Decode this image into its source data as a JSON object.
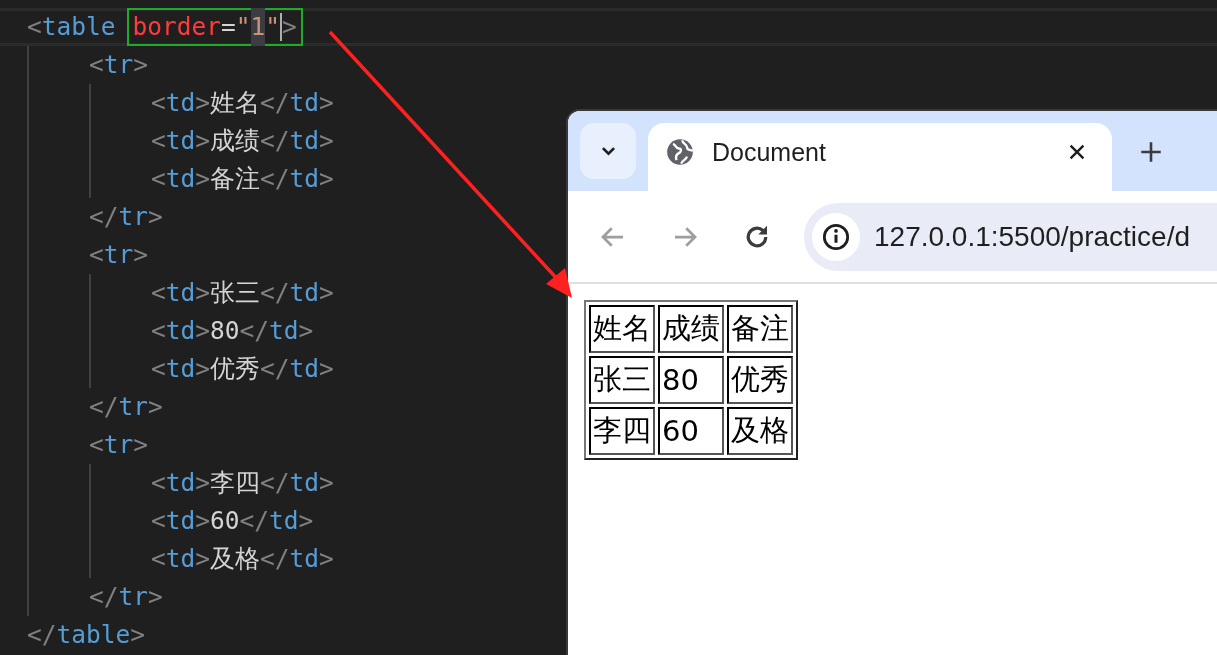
{
  "editor": {
    "lines": [
      {
        "current": true,
        "tokens": [
          {
            "kind": "punct",
            "text": "<"
          },
          {
            "kind": "tag",
            "text": "table"
          },
          {
            "kind": "boxed",
            "tokens": [
              {
                "kind": "attr",
                "text": "border"
              },
              {
                "kind": "plain",
                "text": "="
              },
              {
                "kind": "string",
                "text": "\""
              },
              {
                "kind": "string",
                "text": "1",
                "selected": true
              },
              {
                "kind": "string",
                "text": "\""
              },
              {
                "kind": "cursor"
              },
              {
                "kind": "punct",
                "text": ">"
              }
            ]
          }
        ],
        "children": [
          {
            "tokens": [
              {
                "kind": "punct",
                "text": "<"
              },
              {
                "kind": "tag",
                "text": "tr"
              },
              {
                "kind": "punct",
                "text": ">"
              }
            ],
            "children": [
              {
                "tokens": [
                  {
                    "kind": "punct",
                    "text": "<"
                  },
                  {
                    "kind": "tag",
                    "text": "td"
                  },
                  {
                    "kind": "punct",
                    "text": ">"
                  },
                  {
                    "kind": "plain",
                    "text": "姓名"
                  },
                  {
                    "kind": "punct",
                    "text": "</"
                  },
                  {
                    "kind": "tag",
                    "text": "td"
                  },
                  {
                    "kind": "punct",
                    "text": ">"
                  }
                ]
              },
              {
                "tokens": [
                  {
                    "kind": "punct",
                    "text": "<"
                  },
                  {
                    "kind": "tag",
                    "text": "td"
                  },
                  {
                    "kind": "punct",
                    "text": ">"
                  },
                  {
                    "kind": "plain",
                    "text": "成绩"
                  },
                  {
                    "kind": "punct",
                    "text": "</"
                  },
                  {
                    "kind": "tag",
                    "text": "td"
                  },
                  {
                    "kind": "punct",
                    "text": ">"
                  }
                ]
              },
              {
                "tokens": [
                  {
                    "kind": "punct",
                    "text": "<"
                  },
                  {
                    "kind": "tag",
                    "text": "td"
                  },
                  {
                    "kind": "punct",
                    "text": ">"
                  },
                  {
                    "kind": "plain",
                    "text": "备注"
                  },
                  {
                    "kind": "punct",
                    "text": "</"
                  },
                  {
                    "kind": "tag",
                    "text": "td"
                  },
                  {
                    "kind": "punct",
                    "text": ">"
                  }
                ]
              }
            ]
          },
          {
            "tokens": [
              {
                "kind": "punct",
                "text": "</"
              },
              {
                "kind": "tag",
                "text": "tr"
              },
              {
                "kind": "punct",
                "text": ">"
              }
            ]
          },
          {
            "tokens": [
              {
                "kind": "punct",
                "text": "<"
              },
              {
                "kind": "tag",
                "text": "tr"
              },
              {
                "kind": "punct",
                "text": ">"
              }
            ],
            "children": [
              {
                "tokens": [
                  {
                    "kind": "punct",
                    "text": "<"
                  },
                  {
                    "kind": "tag",
                    "text": "td"
                  },
                  {
                    "kind": "punct",
                    "text": ">"
                  },
                  {
                    "kind": "plain",
                    "text": "张三"
                  },
                  {
                    "kind": "punct",
                    "text": "</"
                  },
                  {
                    "kind": "tag",
                    "text": "td"
                  },
                  {
                    "kind": "punct",
                    "text": ">"
                  }
                ]
              },
              {
                "tokens": [
                  {
                    "kind": "punct",
                    "text": "<"
                  },
                  {
                    "kind": "tag",
                    "text": "td"
                  },
                  {
                    "kind": "punct",
                    "text": ">"
                  },
                  {
                    "kind": "plain",
                    "text": "80"
                  },
                  {
                    "kind": "punct",
                    "text": "</"
                  },
                  {
                    "kind": "tag",
                    "text": "td"
                  },
                  {
                    "kind": "punct",
                    "text": ">"
                  }
                ]
              },
              {
                "tokens": [
                  {
                    "kind": "punct",
                    "text": "<"
                  },
                  {
                    "kind": "tag",
                    "text": "td"
                  },
                  {
                    "kind": "punct",
                    "text": ">"
                  },
                  {
                    "kind": "plain",
                    "text": "优秀"
                  },
                  {
                    "kind": "punct",
                    "text": "</"
                  },
                  {
                    "kind": "tag",
                    "text": "td"
                  },
                  {
                    "kind": "punct",
                    "text": ">"
                  }
                ]
              }
            ]
          },
          {
            "tokens": [
              {
                "kind": "punct",
                "text": "</"
              },
              {
                "kind": "tag",
                "text": "tr"
              },
              {
                "kind": "punct",
                "text": ">"
              }
            ]
          },
          {
            "tokens": [
              {
                "kind": "punct",
                "text": "<"
              },
              {
                "kind": "tag",
                "text": "tr"
              },
              {
                "kind": "punct",
                "text": ">"
              }
            ],
            "children": [
              {
                "tokens": [
                  {
                    "kind": "punct",
                    "text": "<"
                  },
                  {
                    "kind": "tag",
                    "text": "td"
                  },
                  {
                    "kind": "punct",
                    "text": ">"
                  },
                  {
                    "kind": "plain",
                    "text": "李四"
                  },
                  {
                    "kind": "punct",
                    "text": "</"
                  },
                  {
                    "kind": "tag",
                    "text": "td"
                  },
                  {
                    "kind": "punct",
                    "text": ">"
                  }
                ]
              },
              {
                "tokens": [
                  {
                    "kind": "punct",
                    "text": "<"
                  },
                  {
                    "kind": "tag",
                    "text": "td"
                  },
                  {
                    "kind": "punct",
                    "text": ">"
                  },
                  {
                    "kind": "plain",
                    "text": "60"
                  },
                  {
                    "kind": "punct",
                    "text": "</"
                  },
                  {
                    "kind": "tag",
                    "text": "td"
                  },
                  {
                    "kind": "punct",
                    "text": ">"
                  }
                ]
              },
              {
                "tokens": [
                  {
                    "kind": "punct",
                    "text": "<"
                  },
                  {
                    "kind": "tag",
                    "text": "td"
                  },
                  {
                    "kind": "punct",
                    "text": ">"
                  },
                  {
                    "kind": "plain",
                    "text": "及格"
                  },
                  {
                    "kind": "punct",
                    "text": "</"
                  },
                  {
                    "kind": "tag",
                    "text": "td"
                  },
                  {
                    "kind": "punct",
                    "text": ">"
                  }
                ]
              }
            ]
          },
          {
            "tokens": [
              {
                "kind": "punct",
                "text": "</"
              },
              {
                "kind": "tag",
                "text": "tr"
              },
              {
                "kind": "punct",
                "text": ">"
              }
            ]
          }
        ]
      },
      {
        "tokens": [
          {
            "kind": "punct",
            "text": "</"
          },
          {
            "kind": "tag",
            "text": "table"
          },
          {
            "kind": "punct",
            "text": ">"
          }
        ]
      }
    ]
  },
  "browser": {
    "tabs": [
      {
        "title": "Document",
        "selected": true
      }
    ],
    "nav": [
      {
        "kind": "back",
        "disabled": true
      },
      {
        "kind": "forward",
        "disabled": true
      },
      {
        "kind": "reload",
        "disabled": false
      }
    ],
    "address": "127.0.0.1:5500/practice/d",
    "page_table": {
      "rows": [
        [
          "姓名",
          "成绩",
          "备注"
        ],
        [
          "张三",
          "80",
          "优秀"
        ],
        [
          "李四",
          "60",
          "及格"
        ]
      ]
    }
  }
}
